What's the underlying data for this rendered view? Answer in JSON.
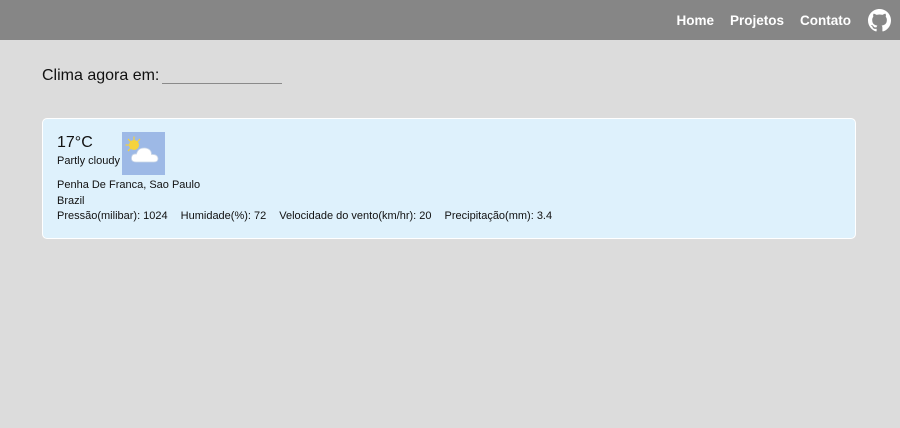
{
  "nav": {
    "items": [
      {
        "label": "Home"
      },
      {
        "label": "Projetos"
      },
      {
        "label": "Contato"
      }
    ],
    "github_icon": "github-icon"
  },
  "search": {
    "label": "Clima agora em:",
    "value": "",
    "placeholder": ""
  },
  "weather": {
    "temperature": "17°C",
    "condition": "Partly cloudy",
    "condition_icon": "partly-cloudy-icon",
    "location": "Penha De Franca, Sao Paulo",
    "country": "Brazil",
    "pressure": "Pressão(milibar): 1024",
    "humidity": "Humidade(%): 72",
    "wind": "Velocidade do vento(km/hr): 20",
    "precipitation": "Precipitação(mm): 3.4"
  },
  "colors": {
    "topbar": "#868686",
    "background": "#dcdcdc",
    "card": "#def1fc",
    "icon_bg": "#9db9e6"
  }
}
